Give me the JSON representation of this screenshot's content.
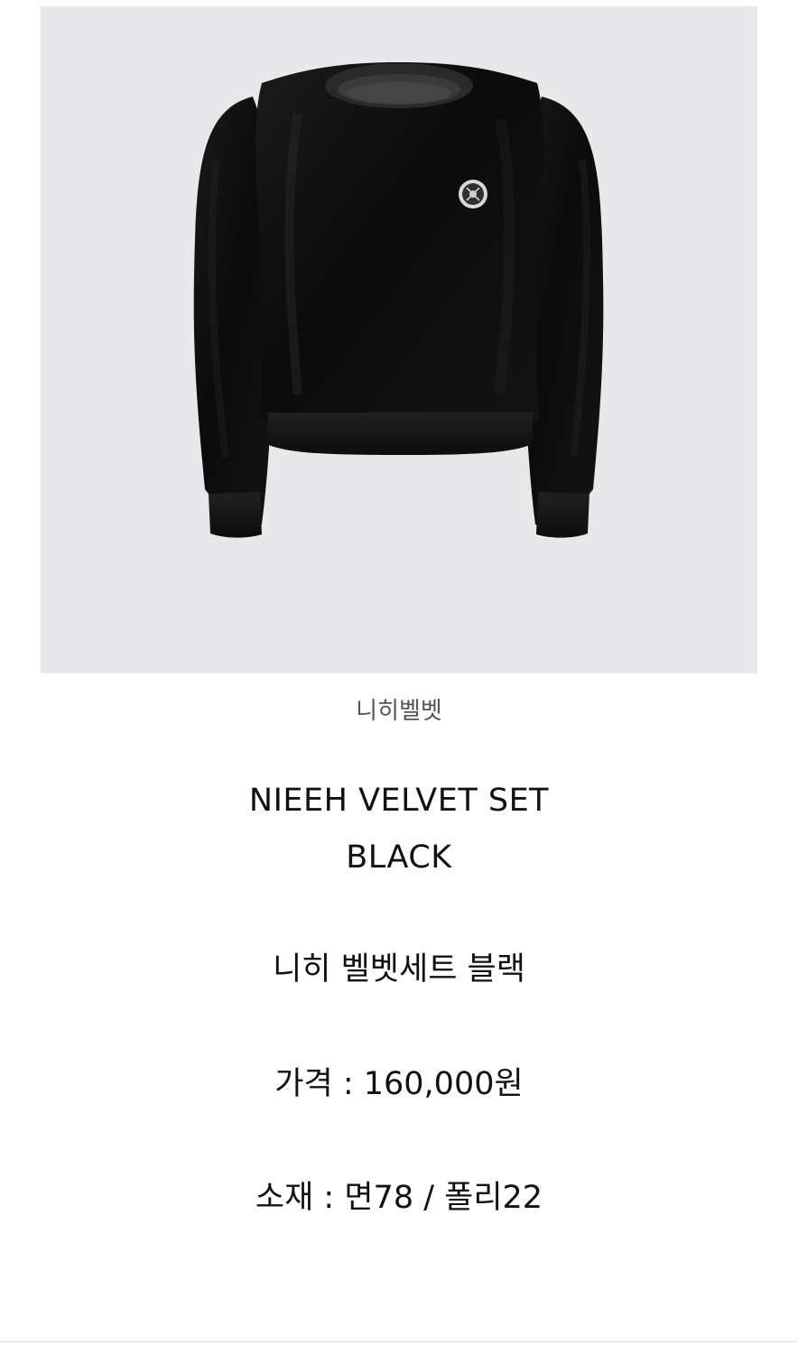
{
  "product": {
    "image": {
      "subject": "black velvet sweatshirt",
      "background_color": "#e8e8ea",
      "garment_color": "#111111",
      "logo_badge": "circular monogram badge"
    },
    "caption": "니히벨벳",
    "name_en": "NIEEH VELVET SET",
    "color_en": "BLACK",
    "name_ko": "니히 벨벳세트 블랙",
    "price_line": "가격 : 160,000원",
    "material_line": "소재 : 면78 / 폴리22"
  }
}
